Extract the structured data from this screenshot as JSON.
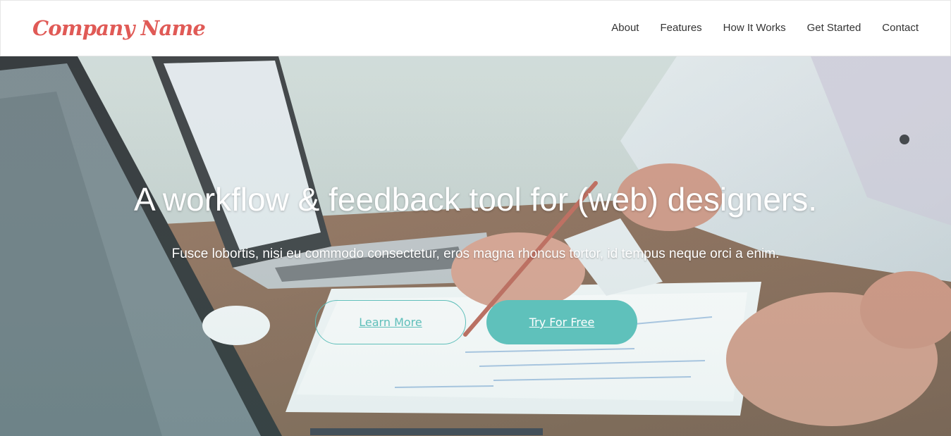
{
  "navbar": {
    "brand": "Company Name",
    "links": [
      "About",
      "Features",
      "How It Works",
      "Get Started",
      "Contact"
    ]
  },
  "hero": {
    "headline": "A workflow & feedback tool for (web) designers.",
    "subline": "Fusce lobortis, nisi eu commodo consectetur, eros magna rhoncus tortor, id tempus neque orci a enim.",
    "buttons": {
      "learn_more": "Learn More",
      "try_free": "Try For Free"
    }
  },
  "colors": {
    "brand": "#e05a56",
    "accent": "#5fc1bb",
    "nav_text": "#333333"
  }
}
